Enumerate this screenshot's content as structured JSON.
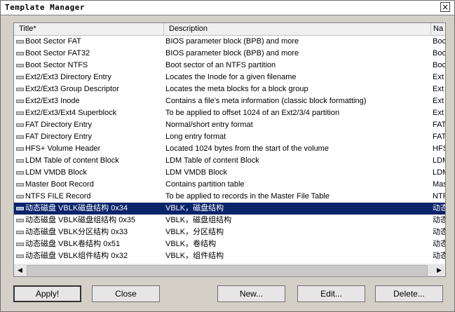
{
  "window": {
    "title": "Template Manager",
    "close_glyph": "×"
  },
  "list": {
    "columns": [
      "Title*",
      "Description",
      "Na"
    ],
    "rows": [
      {
        "title": "Boot Sector FAT",
        "desc": "BIOS parameter block (BPB) and more",
        "name": "Boo"
      },
      {
        "title": "Boot Sector FAT32",
        "desc": "BIOS parameter block (BPB) and more",
        "name": "Boo"
      },
      {
        "title": "Boot Sector NTFS",
        "desc": "Boot sector of an NTFS partition",
        "name": "Boo"
      },
      {
        "title": "Ext2/Ext3 Directory Entry",
        "desc": "Locates the Inode for a given filename",
        "name": "Ext"
      },
      {
        "title": "Ext2/Ext3 Group Descriptor",
        "desc": "Locates the meta blocks for a block group",
        "name": "Ext"
      },
      {
        "title": "Ext2/Ext3 Inode",
        "desc": "Contains a file's meta information (classic block formatting)",
        "name": "Ext"
      },
      {
        "title": "Ext2/Ext3/Ext4 Superblock",
        "desc": "To be applied to offset 1024 of an Ext2/3/4 partition",
        "name": "Ext"
      },
      {
        "title": "FAT Directory Entry",
        "desc": "Normal/short entry format",
        "name": "FAT"
      },
      {
        "title": "FAT Directory Entry",
        "desc": "Long entry format",
        "name": "FAT"
      },
      {
        "title": "HFS+ Volume Header",
        "desc": "Located 1024 bytes from the start of the volume",
        "name": "HFS"
      },
      {
        "title": "LDM Table of content Block",
        "desc": "LDM Table of content Block",
        "name": "LDM"
      },
      {
        "title": "LDM VMDB Block",
        "desc": "LDM VMDB Block",
        "name": "LDM"
      },
      {
        "title": "Master Boot Record",
        "desc": "Contains partition table",
        "name": "Mas"
      },
      {
        "title": "NTFS FILE Record",
        "desc": "To be applied to records in the Master File Table",
        "name": "NTF"
      },
      {
        "title": "动态磁盘 VBLK磁盘结构 0x34",
        "desc": "VBLK，磁盘结构",
        "name": "动态"
      },
      {
        "title": "动态磁盘 VBLK磁盘组结构 0x35",
        "desc": "VBLK，磁盘组结构",
        "name": "动态"
      },
      {
        "title": "动态磁盘 VBLK分区结构 0x33",
        "desc": "VBLK，分区结构",
        "name": "动态"
      },
      {
        "title": "动态磁盘 VBLK卷结构 0x51",
        "desc": "VBLK，卷结构",
        "name": "动态"
      },
      {
        "title": "动态磁盘 VBLK组件结构 0x32",
        "desc": "VBLK，组件结构",
        "name": "动态"
      }
    ],
    "selected_index": 14,
    "scroll_left": "◀",
    "scroll_right": "▶"
  },
  "buttons": {
    "apply": "Apply!",
    "close": "Close",
    "new": "New...",
    "edit": "Edit...",
    "delete": "Delete..."
  }
}
